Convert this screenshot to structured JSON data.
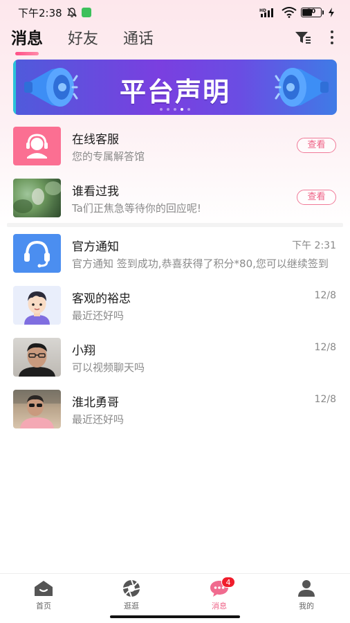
{
  "status_bar": {
    "time": "下午2:38",
    "network": "HD",
    "battery": "30"
  },
  "tabs": [
    {
      "label": "消息",
      "active": true
    },
    {
      "label": "好友",
      "active": false
    },
    {
      "label": "通话",
      "active": false
    }
  ],
  "header_icons": [
    "filter-icon",
    "more-icon"
  ],
  "banner": {
    "title": "平台声明",
    "slide_count": 5,
    "active_slide": 4
  },
  "special_items": [
    {
      "title": "在线客服",
      "subtitle": "您的专属解答馆",
      "action": "查看",
      "icon": "headset-agent-icon",
      "color": "#fb6f92"
    },
    {
      "title": "谁看过我",
      "subtitle": "Ta们正焦急等待你的回应呢!",
      "action": "查看",
      "icon": "blurred-photo"
    }
  ],
  "conversations": [
    {
      "name": "官方通知",
      "preview": "官方通知  签到成功,恭喜获得了积分*80,您可以继续签到",
      "time": "下午 2:31",
      "avatar": "headset-icon",
      "color": "#4b8ef0"
    },
    {
      "name": "客观的裕忠",
      "preview": "最近还好吗",
      "time": "12/8",
      "avatar": "cartoon-boy-avatar"
    },
    {
      "name": "小翔",
      "preview": "可以视频聊天吗",
      "time": "12/8",
      "avatar": "photo-man-glasses"
    },
    {
      "name": "淮北勇哥",
      "preview": "最近还好吗",
      "time": "12/8",
      "avatar": "photo-man-sunglasses"
    }
  ],
  "bottom_nav": [
    {
      "label": "首页",
      "icon": "home-icon",
      "active": false
    },
    {
      "label": "逛逛",
      "icon": "aperture-icon",
      "active": false
    },
    {
      "label": "消息",
      "icon": "chat-bubble-icon",
      "active": true,
      "badge": "4"
    },
    {
      "label": "我的",
      "icon": "person-icon",
      "active": false
    }
  ],
  "colors": {
    "accent": "#ee5f84",
    "badge": "#f01d2c",
    "banner_start": "#4f5bdb",
    "banner_end": "#3f7be6"
  }
}
